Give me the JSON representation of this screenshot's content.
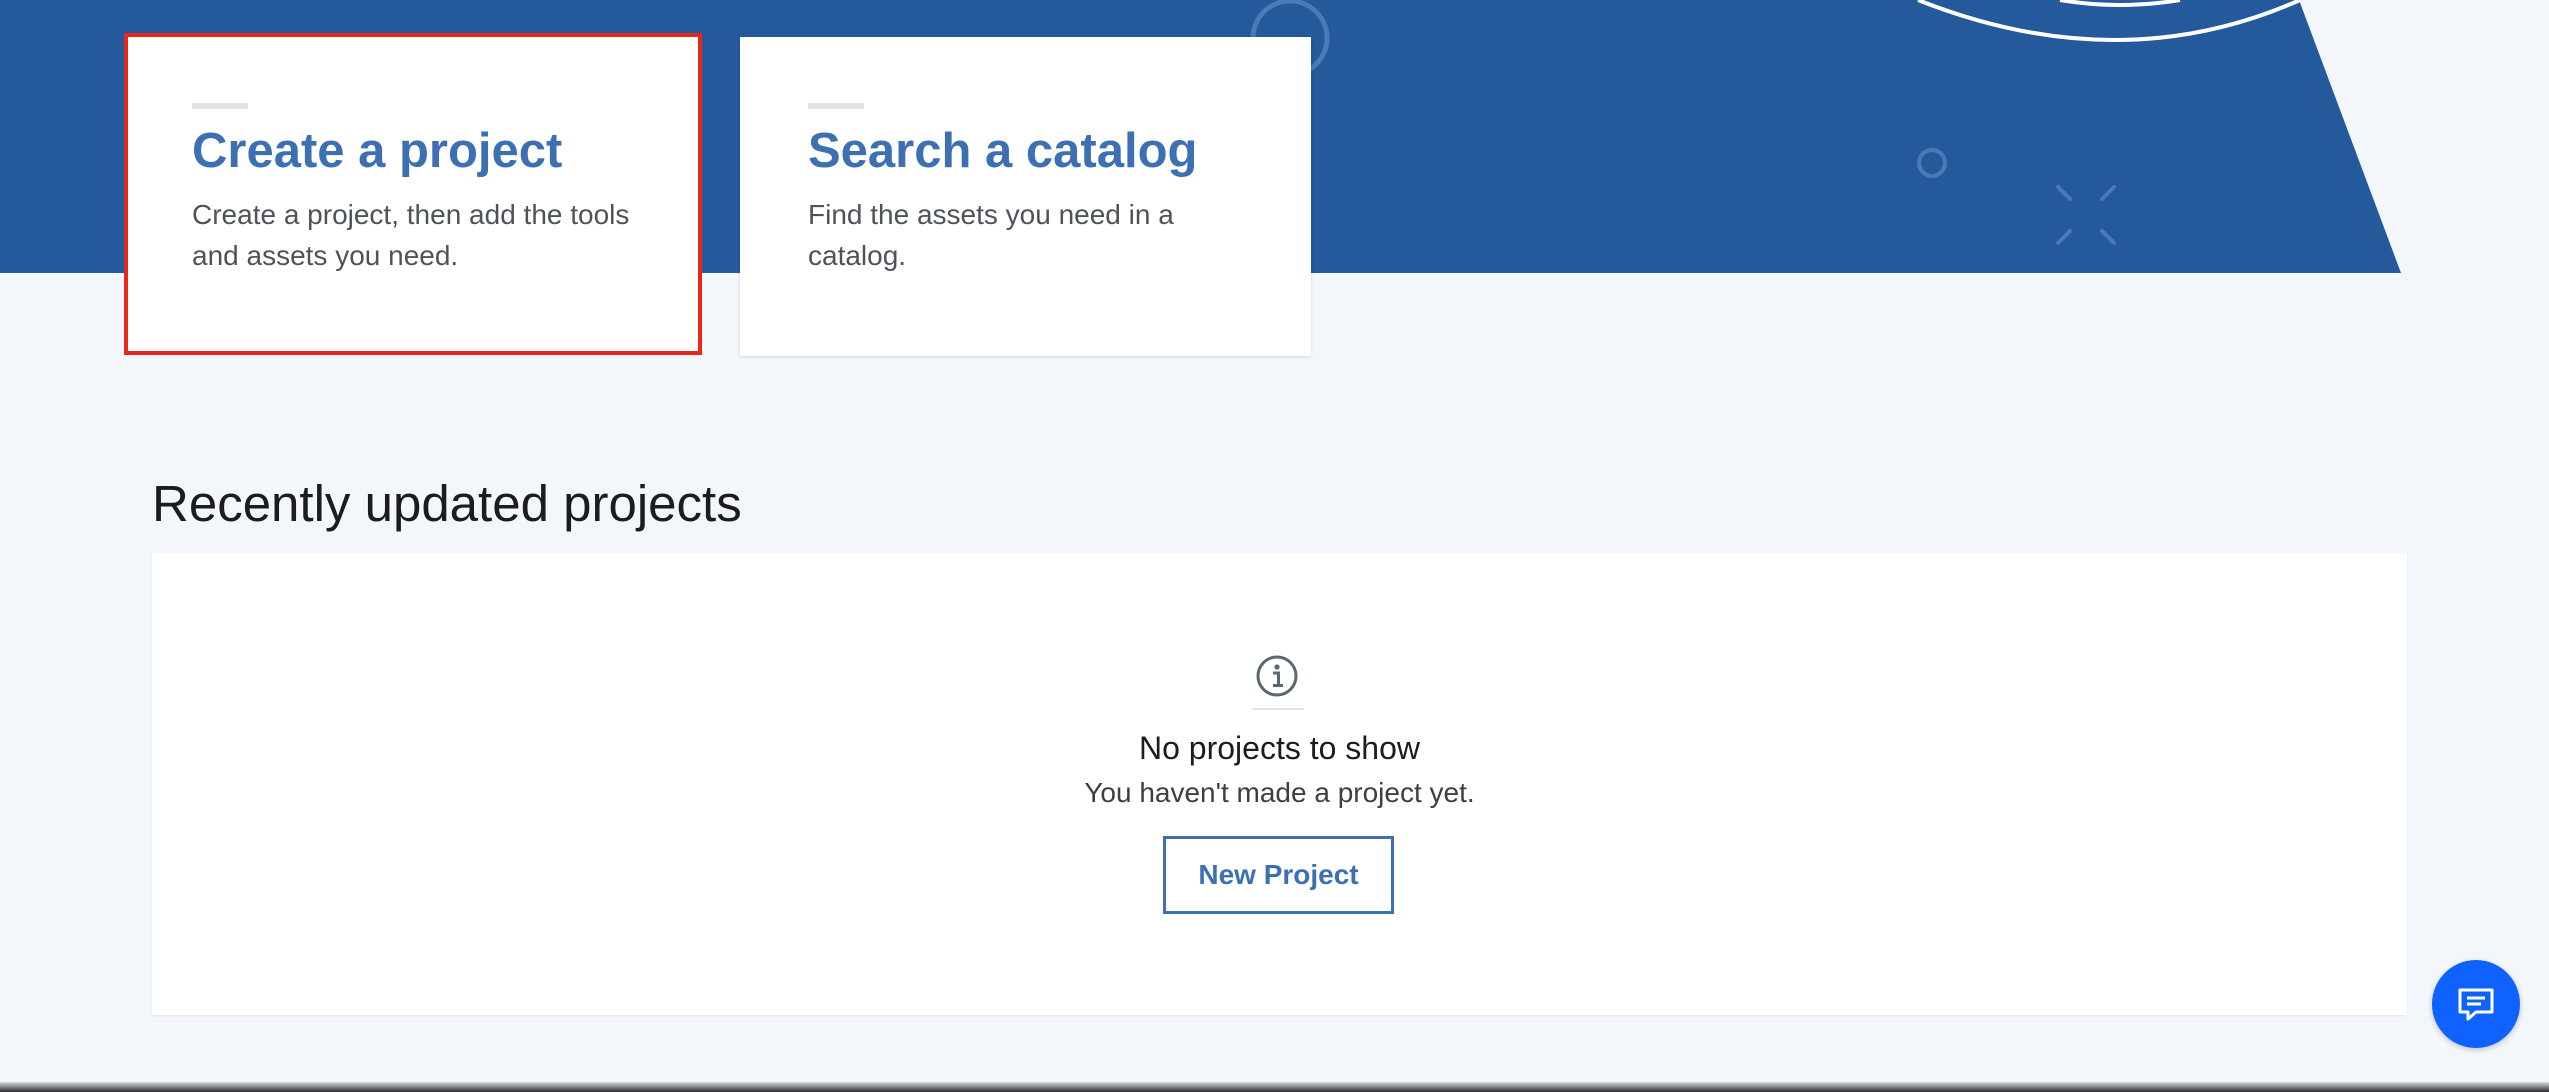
{
  "colors": {
    "hero_blue": "#24599b",
    "card_title": "#3d70b2",
    "highlight_border": "#e8271b",
    "page_background": "#f3f6fa",
    "chat_button": "#0f62fe"
  },
  "cards": [
    {
      "title": "Create a project",
      "description": "Create a project, then add the tools and assets you need.",
      "highlighted": true
    },
    {
      "title": "Search a catalog",
      "description": "Find the assets you need in a catalog.",
      "highlighted": false
    }
  ],
  "recent_projects": {
    "heading": "Recently updated projects",
    "empty_state": {
      "icon": "info-icon",
      "title": "No projects to show",
      "subtitle": "You haven't made a project yet.",
      "button_label": "New Project"
    }
  },
  "chat": {
    "icon": "chat-icon"
  }
}
